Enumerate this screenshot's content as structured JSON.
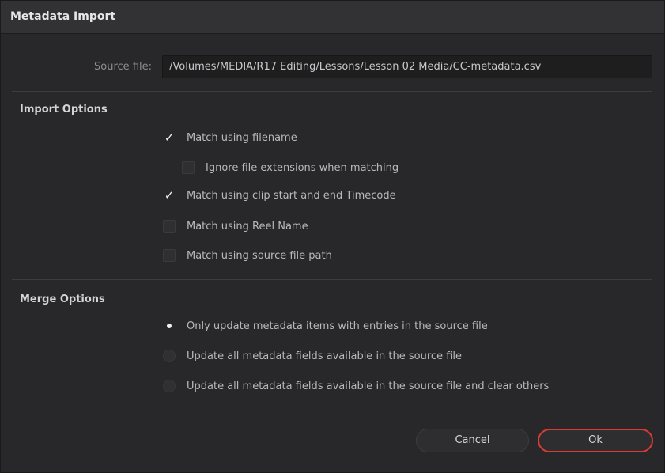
{
  "dialog": {
    "title": "Metadata Import"
  },
  "source": {
    "label": "Source file:",
    "value": "/Volumes/MEDIA/R17 Editing/Lessons/Lesson 02 Media/CC-metadata.csv"
  },
  "import_options": {
    "heading": "Import Options",
    "items": [
      {
        "label": "Match using filename",
        "checked": true
      },
      {
        "label": "Ignore file extensions when matching",
        "checked": false
      },
      {
        "label": "Match using clip start and end Timecode",
        "checked": true
      },
      {
        "label": "Match using Reel Name",
        "checked": false
      },
      {
        "label": "Match using source file path",
        "checked": false
      }
    ]
  },
  "merge_options": {
    "heading": "Merge Options",
    "items": [
      {
        "label": "Only update metadata items with entries in the source file",
        "selected": true
      },
      {
        "label": "Update all metadata fields available in the source file",
        "selected": false
      },
      {
        "label": "Update all metadata fields available in the source file and clear others",
        "selected": false
      }
    ]
  },
  "buttons": {
    "cancel": "Cancel",
    "ok": "Ok"
  },
  "colors": {
    "accent_ok_border": "#d83b34",
    "background": "#28282a"
  },
  "icons": {
    "check": "✓"
  }
}
